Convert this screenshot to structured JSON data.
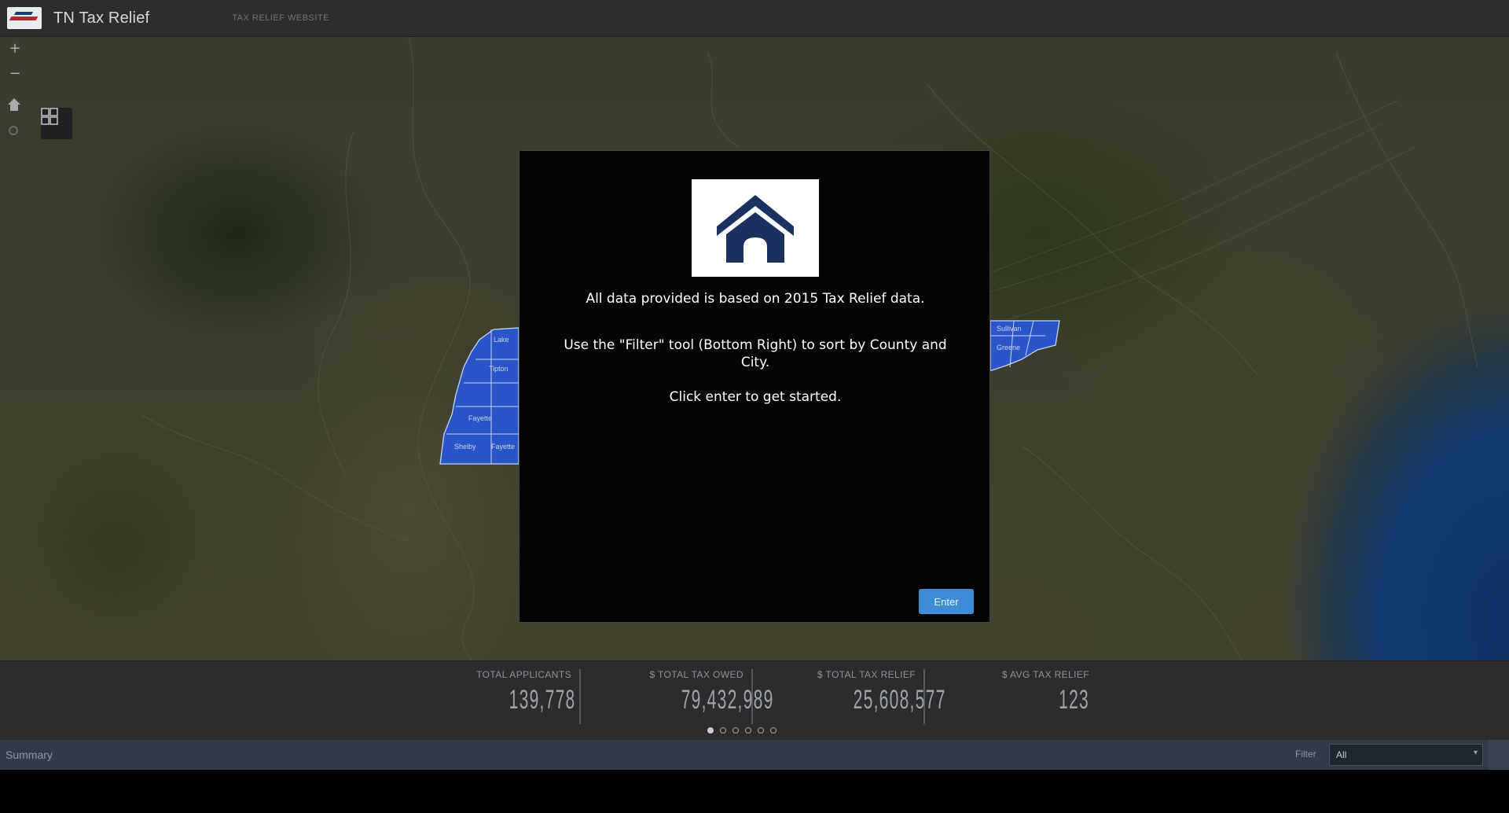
{
  "header": {
    "title": "TN Tax Relief",
    "link": "TAX RELIEF WEBSITE"
  },
  "map_controls": {
    "zoom_in": "+",
    "zoom_out": "−"
  },
  "modal": {
    "line1": "All data provided is based on 2015 Tax Relief data.",
    "line2": "Use the \"Filter\" tool (Bottom Right) to sort by County and City.",
    "line3": "Click enter to get started.",
    "enter_label": "Enter",
    "logo_color": "#1b3160"
  },
  "stats": [
    {
      "label": "TOTAL APPLICANTS",
      "value": "139,778"
    },
    {
      "label": "$ TOTAL TAX OWED",
      "value": "79,432,989"
    },
    {
      "label": "$ TOTAL TAX RELIEF",
      "value": "25,608,577"
    },
    {
      "label": "$ AVG TAX RELIEF",
      "value": "123"
    }
  ],
  "pager": {
    "count": 6,
    "active": 0
  },
  "footer": {
    "summary": "Summary",
    "filter_label": "Filter",
    "filter_value": "All"
  },
  "colors": {
    "county_fill": "#2a55c8",
    "county_stroke": "#c8d4f4",
    "accent_button": "#3c8dd6"
  }
}
